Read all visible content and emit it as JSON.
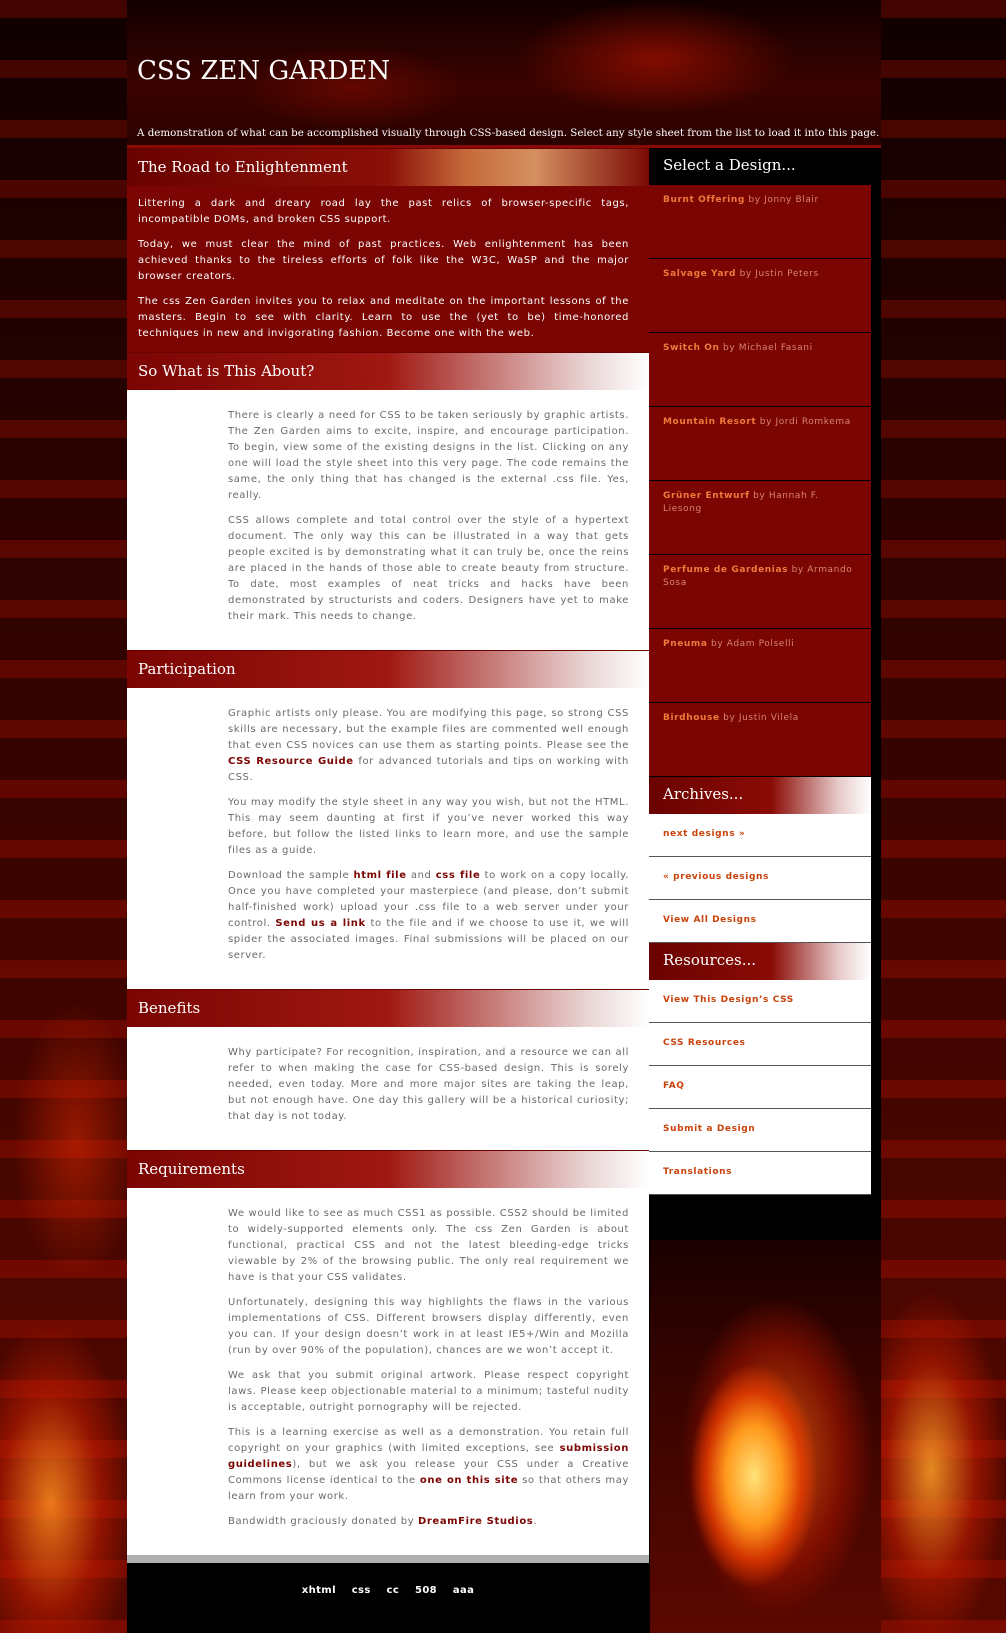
{
  "header": {
    "title": "CSS ZEN GARDEN",
    "tagline": "A demonstration of what can be accomplished visually through CSS-based design. Select any style sheet from the list to load it into this page."
  },
  "intro": {
    "title": "The Road to Enlightenment",
    "paragraphs": [
      "Littering a dark and dreary road lay the past relics of browser-specific tags, incompatible DOMs, and broken CSS support.",
      "Today, we must clear the mind of past practices. Web enlightenment has been achieved thanks to the tireless efforts of folk like the W3C, WaSP and the major browser creators.",
      "The css Zen Garden invites you to relax and meditate on the important lessons of the masters. Begin to see with clarity. Learn to use the (yet to be) time-honored techniques in new and invigorating fashion. Become one with the web."
    ]
  },
  "about": {
    "title": "So What is This About?",
    "p1": "There is clearly a need for CSS to be taken seriously by graphic artists. The Zen Garden aims to excite, inspire, and encourage participation. To begin, view some of the existing designs in the list. Clicking on any one will load the style sheet into this very page. The code remains the same, the only thing that has changed is the external .css file. Yes, really.",
    "p2": "CSS allows complete and total control over the style of a hypertext document. The only way this can be illustrated in a way that gets people excited is by demonstrating what it can truly be, once the reins are placed in the hands of those able to create beauty from structure. To date, most examples of neat tricks and hacks have been demonstrated by structurists and coders. Designers have yet to make their mark. This needs to change."
  },
  "participation": {
    "title": "Participation",
    "p1_a": "Graphic artists only please. You are modifying this page, so strong CSS skills are necessary, but the example files are commented well enough that even CSS novices can use them as starting points. Please see the ",
    "p1_link": "CSS Resource Guide",
    "p1_b": " for advanced tutorials and tips on working with CSS.",
    "p2": "You may modify the style sheet in any way you wish, but not the HTML. This may seem daunting at first if you’ve never worked this way before, but follow the listed links to learn more, and use the sample files as a guide.",
    "p3_a": "Download the sample ",
    "p3_link1": "html file",
    "p3_and": " and ",
    "p3_link2": "css file",
    "p3_b": " to work on a copy locally. Once you have completed your masterpiece (and please, don’t submit half-finished work) upload your .css file to a web server under your control. ",
    "p3_link3": "Send us a link",
    "p3_c": " to the file and if we choose to use it, we will spider the associated images. Final submissions will be placed on our server."
  },
  "benefits": {
    "title": "Benefits",
    "p1": "Why participate? For recognition, inspiration, and a resource we can all refer to when making the case for CSS-based design. This is sorely needed, even today. More and more major sites are taking the leap, but not enough have. One day this gallery will be a historical curiosity; that day is not today."
  },
  "requirements": {
    "title": "Requirements",
    "p1": "We would like to see as much CSS1 as possible. CSS2 should be limited to widely-supported elements only. The css Zen Garden is about functional, practical CSS and not the latest bleeding-edge tricks viewable by 2% of the browsing public. The only real requirement we have is that your CSS validates.",
    "p2": "Unfortunately, designing this way highlights the flaws in the various implementations of CSS. Different browsers display differently, even you can. If your design doesn’t work in at least IE5+/Win and Mozilla (run by over 90% of the population), chances are we won’t accept it.",
    "p3": "We ask that you submit original artwork. Please respect copyright laws. Please keep objectionable material to a minimum; tasteful nudity is acceptable, outright pornography will be rejected.",
    "p4_a": "This is a learning exercise as well as a demonstration. You retain full copyright on your graphics (with limited exceptions, see ",
    "p4_link1": "submission guidelines",
    "p4_b": "), but we ask you release your CSS under a Creative Commons license identical to the ",
    "p4_link2": "one on this site",
    "p4_c": " so that others may learn from your work.",
    "p5_a": "Bandwidth graciously donated by ",
    "p5_link": "DreamFire Studios",
    "p5_b": "."
  },
  "footer": {
    "links": [
      "xhtml",
      "css",
      "cc",
      "508",
      "aaa"
    ]
  },
  "sidebar": {
    "select_title": "Select a Design...",
    "designs": [
      {
        "name": "Burnt Offering",
        "by": "by Jonny Blair"
      },
      {
        "name": "Salvage Yard",
        "by": "by Justin Peters"
      },
      {
        "name": "Switch On",
        "by": "by Michael Fasani"
      },
      {
        "name": "Mountain Resort",
        "by": "by Jordi Romkema"
      },
      {
        "name": "Grüner Entwurf",
        "by": "by Hannah F. Liesong"
      },
      {
        "name": "Perfume de Gardenias",
        "by": "by Armando Sosa"
      },
      {
        "name": "Pneuma",
        "by": "by Adam Polselli"
      },
      {
        "name": "Birdhouse",
        "by": "by Justin Vilela"
      }
    ],
    "archives_title": "Archives...",
    "archives": [
      "next designs »",
      "« previous designs",
      "View All Designs"
    ],
    "resources_title": "Resources...",
    "resources": [
      "View This Design’s CSS",
      "CSS Resources",
      "FAQ",
      "Submit a Design",
      "Translations"
    ]
  }
}
